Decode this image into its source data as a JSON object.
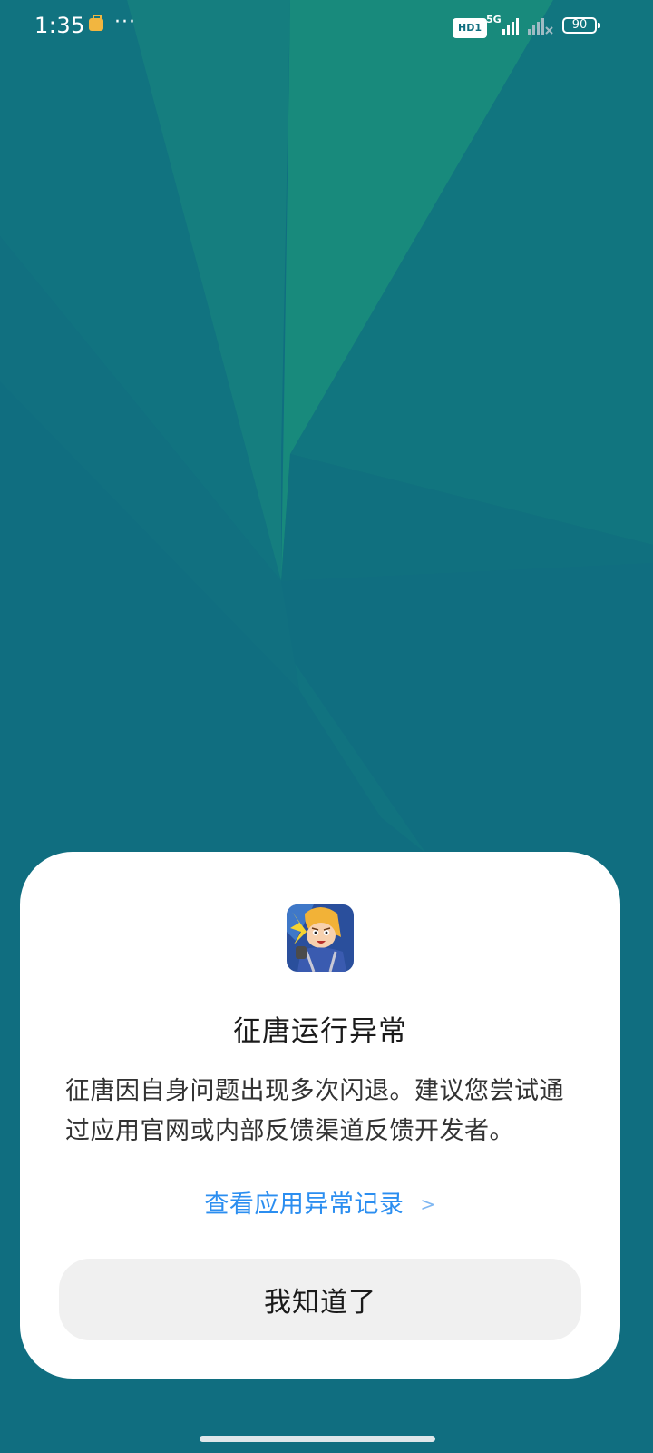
{
  "status_bar": {
    "time": "1:35",
    "more_dots": "···",
    "hd_label": "HD1",
    "network_type": "5G",
    "battery_level": "90"
  },
  "dialog": {
    "app_icon": "game-hero-character-icon",
    "title": "征唐运行异常",
    "message": "征唐因自身问题出现多次闪退。建议您尝试通过应用官网或内部反馈渠道反馈开发者。",
    "link_label": "查看应用异常记录",
    "link_chevron": ">",
    "ok_label": "我知道了"
  },
  "colors": {
    "background": "#106e80",
    "link": "#2b8ef0",
    "button_bg": "#f0f0f0"
  }
}
